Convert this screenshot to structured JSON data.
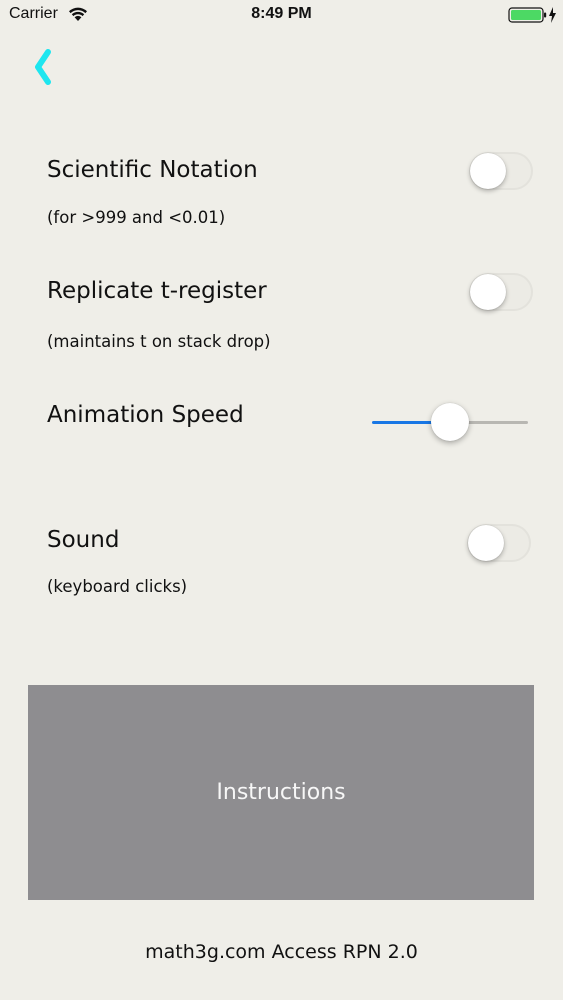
{
  "status_bar": {
    "carrier": "Carrier",
    "time": "8:49 PM",
    "wifi_icon": "wifi-icon",
    "battery_icon": "battery-charging-icon",
    "battery_color": "#4cd964"
  },
  "nav": {
    "back_icon": "chevron-left-icon",
    "back_color": "#1ee6ef"
  },
  "settings": {
    "scientific_notation": {
      "title": "Scientific Notation",
      "subtitle": "(for >999 and <0.01)",
      "on": false
    },
    "replicate_t_register": {
      "title": "Replicate t-register",
      "subtitle": "(maintains t on stack drop)",
      "on": false
    },
    "animation_speed": {
      "title": "Animation Speed",
      "value": 0.5,
      "min_track_color": "#1877e5"
    },
    "sound": {
      "title": "Sound",
      "subtitle": "(keyboard clicks)",
      "on": false
    }
  },
  "instructions_button": {
    "label": "Instructions"
  },
  "footer": {
    "text": "math3g.com  Access RPN 2.0"
  }
}
